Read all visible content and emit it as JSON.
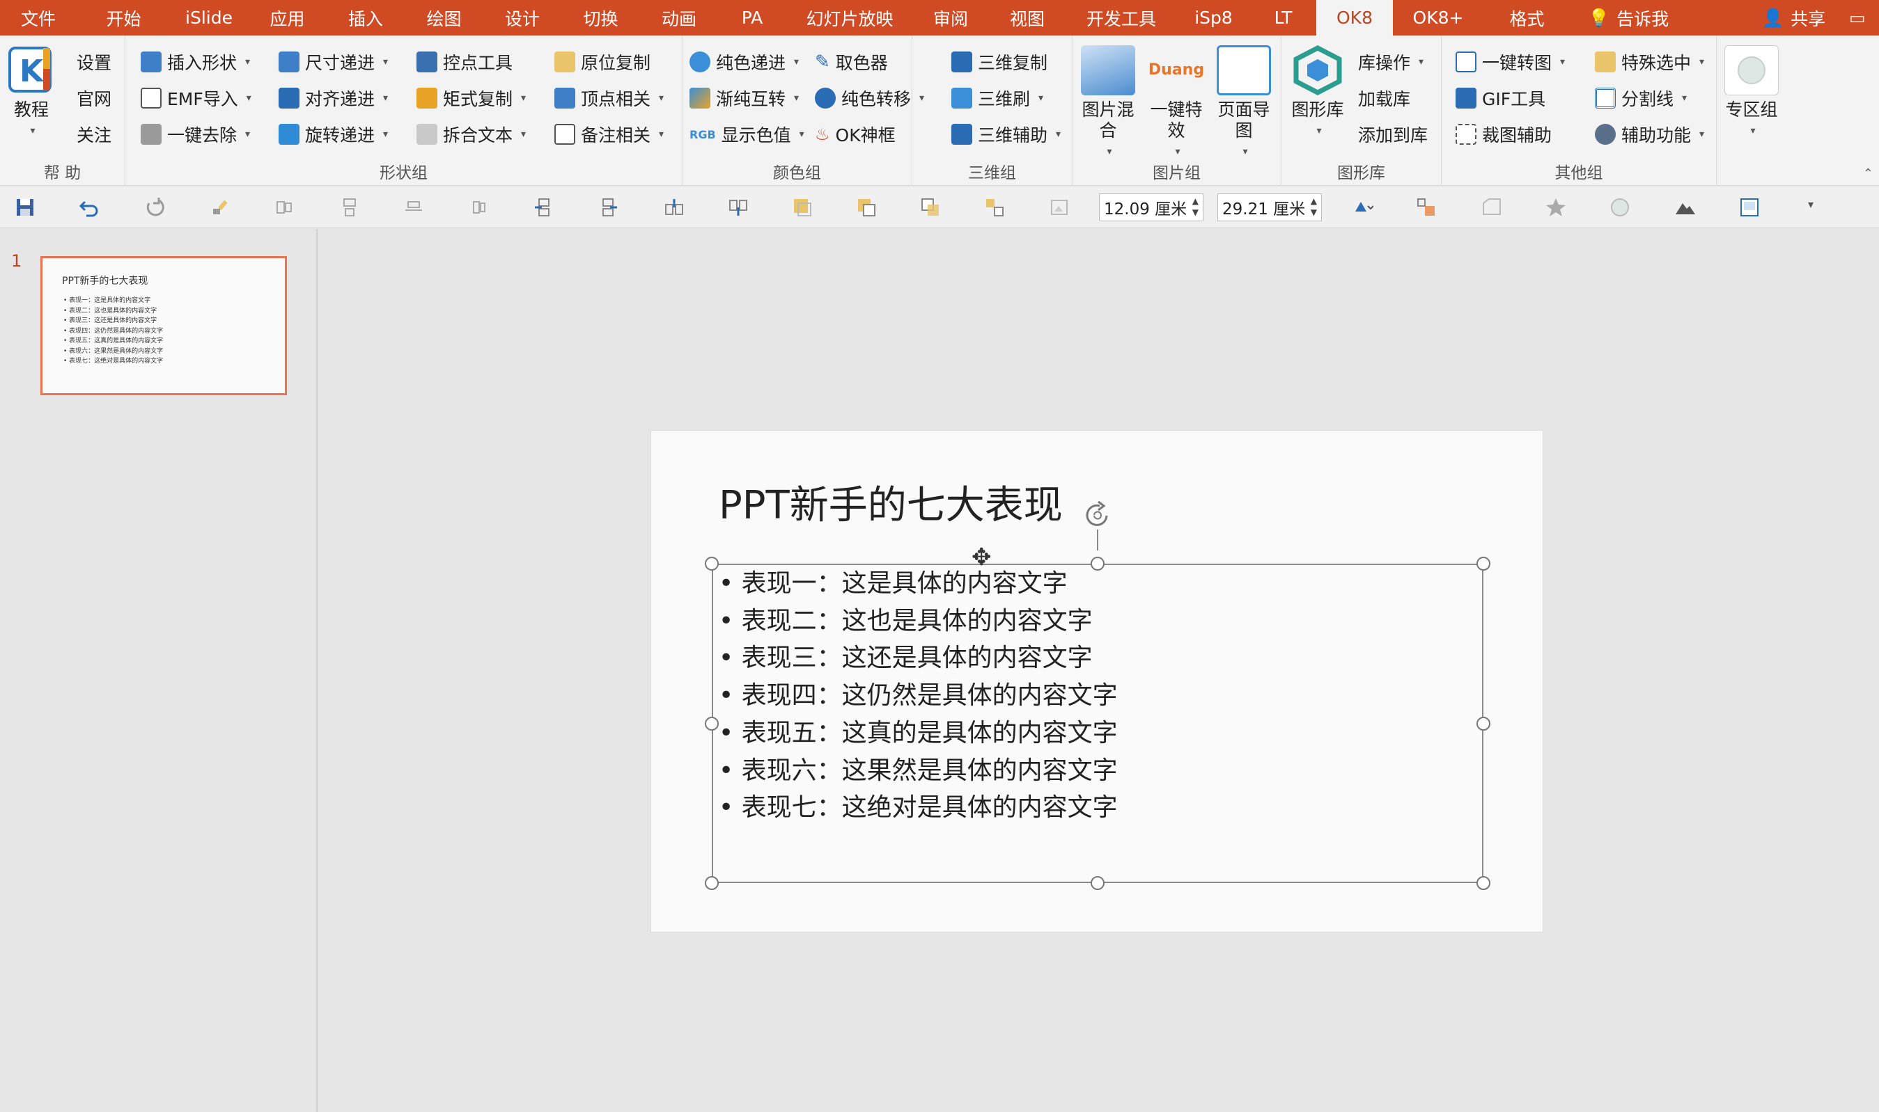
{
  "tabs": [
    "文件",
    "开始",
    "iSlide",
    "应用",
    "插入",
    "绘图",
    "设计",
    "切换",
    "动画",
    "PA",
    "幻灯片放映",
    "审阅",
    "视图",
    "开发工具",
    "iSp8",
    "LT",
    "OK8",
    "OK8+",
    "格式"
  ],
  "active_tab": "OK8",
  "tell_me": "告诉我",
  "share": "共享",
  "ribbon": {
    "help": {
      "label": "帮 助",
      "big": "教程",
      "items": [
        "设置",
        "官网",
        "关注"
      ]
    },
    "shape": {
      "label": "形状组",
      "items": [
        "插入形状",
        "EMF导入",
        "一键去除",
        "尺寸递进",
        "对齐递进",
        "旋转递进",
        "控点工具",
        "矩式复制",
        "拆合文本",
        "原位复制",
        "顶点相关",
        "备注相关"
      ]
    },
    "color": {
      "label": "颜色组",
      "items": [
        "纯色递进",
        "渐纯互转",
        "显示色值",
        "取色器",
        "纯色转移",
        "OK神框"
      ],
      "rgb": "RGB"
    },
    "threed": {
      "label": "三维组",
      "items": [
        "三维复制",
        "三维刷",
        "三维辅助"
      ]
    },
    "picture": {
      "label": "图片组",
      "big": [
        "图片混合",
        "一键特效",
        "页面导图"
      ],
      "duang": "Duang"
    },
    "library": {
      "label": "图形库",
      "big": "图形库",
      "items": [
        "库操作",
        "加载库",
        "添加到库"
      ]
    },
    "other": {
      "label": "其他组",
      "items": [
        "一键转图",
        "GIF工具",
        "裁图辅助",
        "特殊选中",
        "分割线",
        "辅助功能"
      ]
    },
    "zone": {
      "big": "专区组"
    }
  },
  "qat": {
    "height_value": "12.09 厘米",
    "width_value": "29.21 厘米"
  },
  "thumbnail": {
    "number": "1",
    "title": "PPT新手的七大表现",
    "bullets": [
      "• 表现一：这是具体的内容文字",
      "• 表现二：这也是具体的内容文字",
      "• 表现三：这还是具体的内容文字",
      "• 表现四：这仍然是具体的内容文字",
      "• 表现五：这真的是具体的内容文字",
      "• 表现六：这果然是具体的内容文字",
      "• 表现七：这绝对是具体的内容文字"
    ]
  },
  "slide": {
    "title": "PPT新手的七大表现",
    "bullets": [
      "• 表现一：这是具体的内容文字",
      "• 表现二：这也是具体的内容文字",
      "• 表现三：这还是具体的内容文字",
      "• 表现四：这仍然是具体的内容文字",
      "• 表现五：这真的是具体的内容文字",
      "• 表现六：这果然是具体的内容文字",
      "• 表现七：这绝对是具体的内容文字"
    ]
  },
  "colors": {
    "accent": "#d04a24",
    "ribbon_bg": "#f3f3f3",
    "slide_border": "#e8754f"
  }
}
